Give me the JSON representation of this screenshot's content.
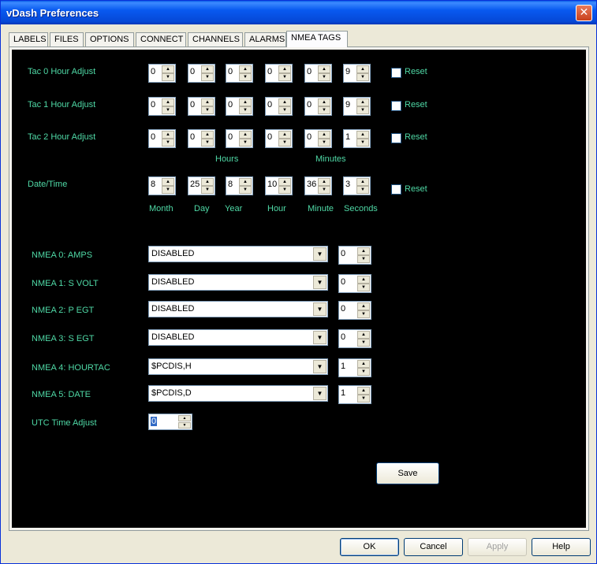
{
  "window": {
    "title": "vDash Preferences",
    "close_glyph": "✕"
  },
  "tabs": [
    "LABELS",
    "FILES",
    "OPTIONS",
    "CONNECT",
    "CHANNELS",
    "ALARMS",
    "NMEA TAGS"
  ],
  "active_tab": "NMEA TAGS",
  "tac_rows": [
    {
      "label": "Tac 0 Hour Adjust",
      "values": [
        "0",
        "0",
        "0",
        "0",
        "0",
        "9"
      ],
      "reset": "Reset"
    },
    {
      "label": "Tac 1 Hour Adjust",
      "values": [
        "0",
        "0",
        "0",
        "0",
        "0",
        "9"
      ],
      "reset": "Reset"
    },
    {
      "label": "Tac 2 Hour Adjust",
      "values": [
        "0",
        "0",
        "0",
        "0",
        "0",
        "1"
      ],
      "reset": "Reset"
    }
  ],
  "group_labels": {
    "hours": "Hours",
    "minutes": "Minutes"
  },
  "datetime": {
    "label": "Date/Time",
    "values": [
      "8",
      "25",
      "8",
      "10",
      "36",
      "3"
    ],
    "captions": [
      "Month",
      "Day",
      "Year",
      "Hour",
      "Minute",
      "Seconds"
    ],
    "reset": "Reset"
  },
  "nmea_rows": [
    {
      "label": "NMEA 0: AMPS",
      "selection": "DISABLED",
      "value": "0"
    },
    {
      "label": "NMEA 1: S VOLT",
      "selection": "DISABLED",
      "value": "0"
    },
    {
      "label": "NMEA 2: P EGT",
      "selection": "DISABLED",
      "value": "0"
    },
    {
      "label": "NMEA 3: S EGT",
      "selection": "DISABLED",
      "value": "0"
    },
    {
      "label": "NMEA 4: HOURTAC",
      "selection": "$PCDIS,H",
      "value": "1"
    },
    {
      "label": "NMEA 5: DATE",
      "selection": "$PCDIS,D",
      "value": "1"
    }
  ],
  "utc": {
    "label": "UTC Time Adjust",
    "value": "0"
  },
  "save_label": "Save",
  "footer_buttons": {
    "ok": "OK",
    "cancel": "Cancel",
    "apply": "Apply",
    "help": "Help"
  },
  "colors": {
    "label_green": "#4fd9a6",
    "panel_bg": "#000000",
    "title_blue": "#0859f0"
  }
}
